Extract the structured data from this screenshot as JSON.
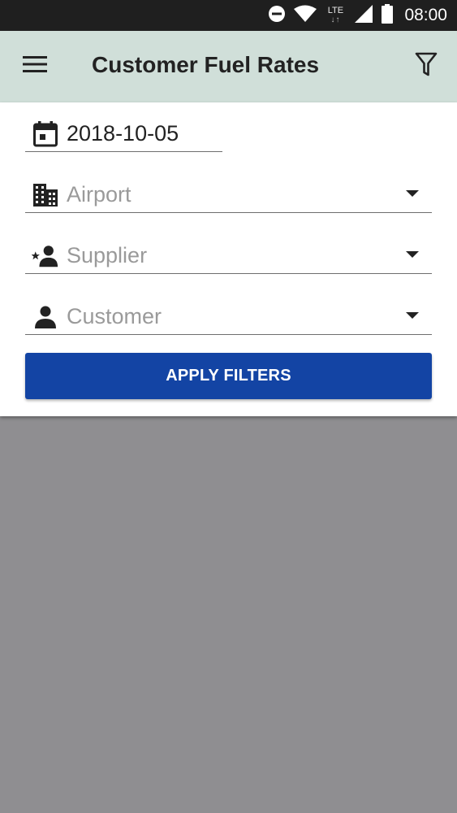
{
  "status_bar": {
    "time": "08:00",
    "network": "LTE",
    "icons": [
      "do-not-disturb-icon",
      "wifi-icon",
      "lte-icon",
      "signal-icon",
      "battery-icon"
    ]
  },
  "app_bar": {
    "title": "Customer Fuel Rates",
    "menu_icon": "hamburger-menu-icon",
    "filter_icon": "filter-icon"
  },
  "filters": {
    "date": {
      "value": "2018-10-05",
      "icon": "calendar-icon"
    },
    "airport": {
      "placeholder": "Airport",
      "icon": "building-icon"
    },
    "supplier": {
      "placeholder": "Supplier",
      "icon": "supplier-star-person-icon"
    },
    "customer": {
      "placeholder": "Customer",
      "icon": "person-icon"
    },
    "apply_label": "APPLY FILTERS"
  },
  "colors": {
    "app_bar_bg": "#d0dfd9",
    "accent_button": "#1344a4",
    "overlay_bg": "#8f8e91",
    "status_bar_bg": "#1f1f1f"
  }
}
